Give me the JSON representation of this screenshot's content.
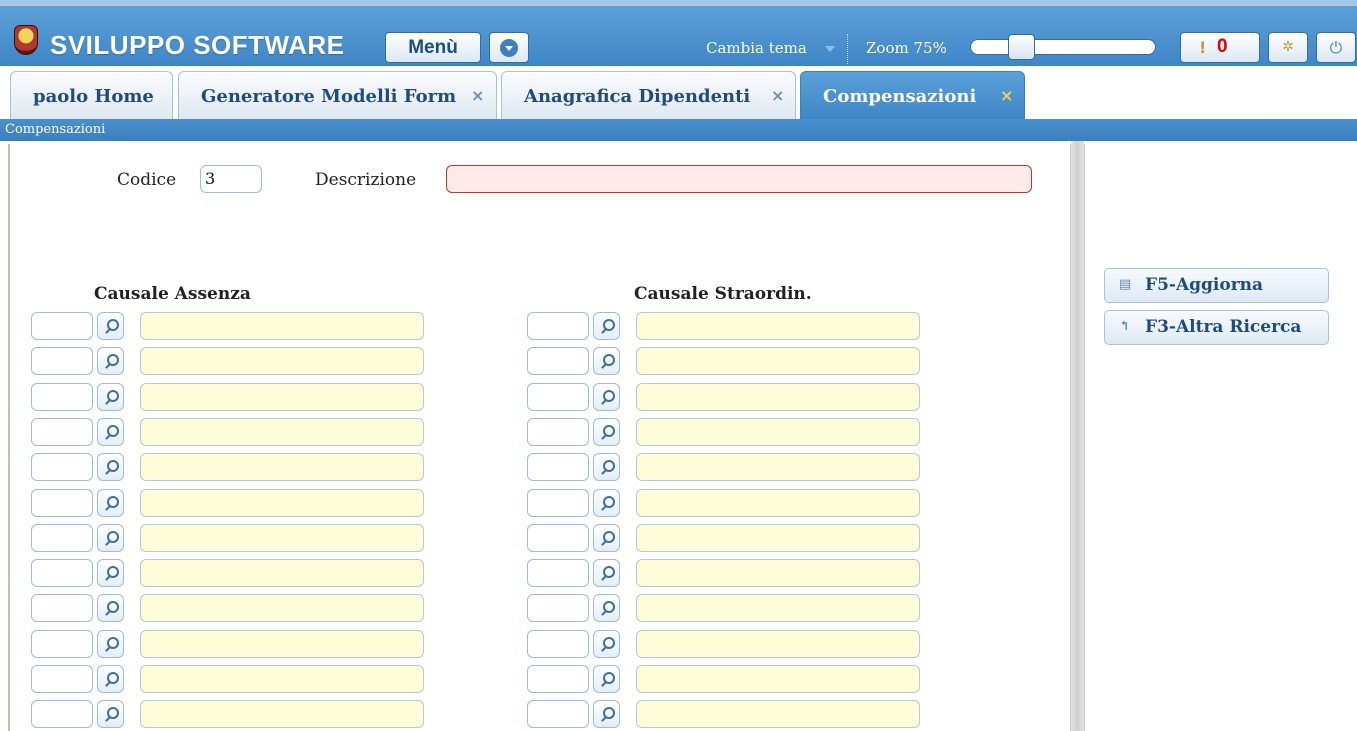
{
  "header": {
    "brand": "SVILUPPO SOFTWARE",
    "menu_label": "Menù",
    "theme_label": "Cambia tema",
    "zoom_label": "Zoom 75%",
    "zoom_level": 0.2,
    "notifications_icon": "!",
    "notifications_count": "0"
  },
  "tabs": [
    {
      "label": "paolo Home",
      "closable": false,
      "active": false
    },
    {
      "label": "Generatore Modelli Form",
      "closable": true,
      "active": false
    },
    {
      "label": "Anagrafica Dipendenti",
      "closable": true,
      "active": false
    },
    {
      "label": "Compensazioni",
      "closable": true,
      "active": true
    }
  ],
  "close_glyph": "×",
  "breadcrumb": "Compensazioni",
  "form": {
    "codice_label": "Codice",
    "codice_value": "3",
    "descrizione_label": "Descrizione",
    "descrizione_value": "",
    "causale_assenza_title": "Causale Assenza",
    "causale_straordin_title": "Causale Straordin.",
    "rows_per_column": 12
  },
  "actions": {
    "aggiorna_label": "F5-Aggiorna",
    "aggiorna_icon": "save-icon",
    "ricerca_label": "F3-Altra Ricerca",
    "ricerca_icon": "undo-icon"
  },
  "colors": {
    "header_blue": "#3f86c8",
    "required_field_border": "#c0392b",
    "lookup_desc_bg": "#fefdd9"
  }
}
